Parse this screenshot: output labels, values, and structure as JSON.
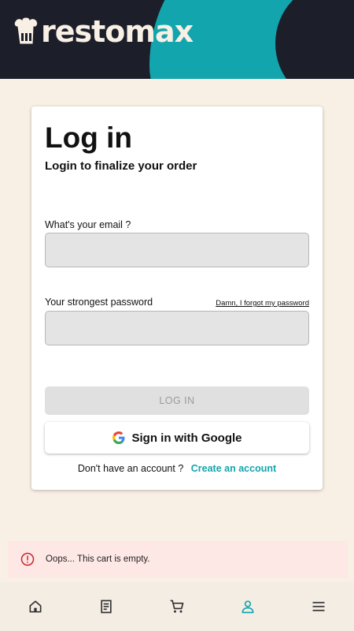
{
  "app": {
    "logo_text": "restomax"
  },
  "login_card": {
    "title": "Log in",
    "subtitle": "Login to finalize your order",
    "email_label": "What's your email ?",
    "email_value": "",
    "password_label": "Your strongest password",
    "password_value": "",
    "forgot_link": "Damn, I forgot my password",
    "login_button": "LOG IN",
    "google_button": "Sign in with Google",
    "no_account_text": "Don't have an account ?",
    "create_account_link": "Create an account"
  },
  "alert": {
    "message": "Oops... This cart is empty.",
    "icon": "error-circle-icon"
  },
  "bottom_nav": {
    "items": [
      {
        "icon": "home-icon",
        "active": false
      },
      {
        "icon": "receipt-icon",
        "active": false
      },
      {
        "icon": "cart-icon",
        "active": false
      },
      {
        "icon": "user-icon",
        "active": true
      },
      {
        "icon": "menu-icon",
        "active": false
      }
    ]
  },
  "colors": {
    "header_bg": "#1c1f2a",
    "accent": "#12a5ad",
    "page_bg": "#f8efe5",
    "alert_bg": "#fde8e6",
    "alert_icon": "#c62828"
  }
}
